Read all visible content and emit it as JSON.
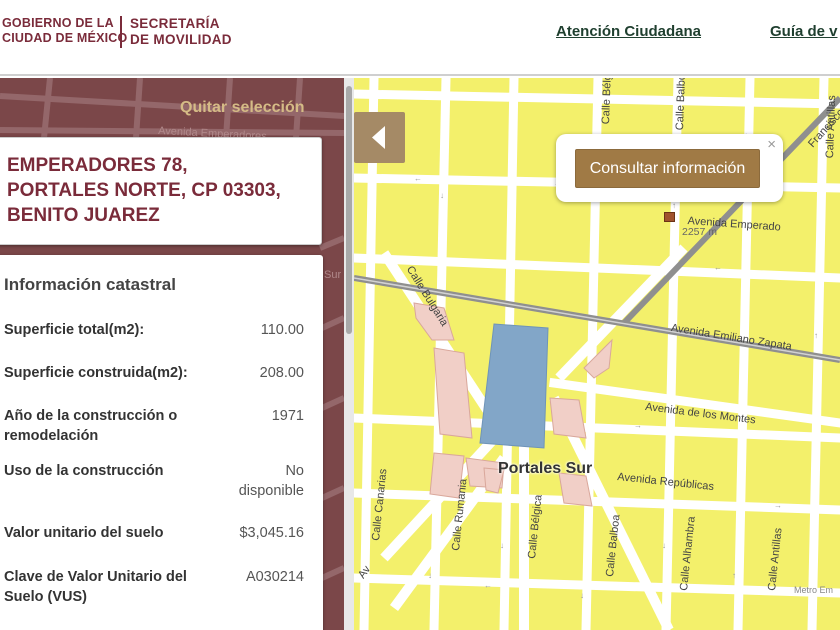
{
  "header": {
    "logo_gov_line1": "GOBIERNO DE LA",
    "logo_gov_line2": "CIUDAD DE MÉXICO",
    "logo_sec_line1": "SECRETARÍA",
    "logo_sec_line2": "DE MOVILIDAD",
    "nav": [
      "Atención Ciudadana",
      "Guía de v"
    ]
  },
  "panel": {
    "quitar_label": "Quitar selección",
    "address_lines": [
      "EMPERADORES 78,",
      "PORTALES NORTE, CP 03303,",
      "BENITO JUAREZ"
    ],
    "info_title": "Información catastral",
    "rows": [
      {
        "label": "Superficie total(m2):",
        "value": "110.00"
      },
      {
        "label": "Superficie construida(m2):",
        "value": "208.00"
      },
      {
        "label": "Año de la construcción o remodelación",
        "value": "1971"
      },
      {
        "label": "Uso de la construcción",
        "value": "No disponible"
      },
      {
        "label": "Valor unitario del suelo",
        "value": "$3,045.16"
      },
      {
        "label": "Clave de Valor Unitario del Suelo (VUS)",
        "value": "A030214"
      }
    ]
  },
  "map": {
    "popup_button": "Consultar información",
    "popup_close": "×",
    "distance_label": "2257 m",
    "place_label": "Portales Sur",
    "attribution": "Metro Em",
    "streets": {
      "emperadores": "Avenida Emperado",
      "zapata": "Avenida Emiliano Zapata",
      "montes": "Avenida de los Montes",
      "republicas": "Avenida Repúblicas",
      "bulgaria": "Calle Bulgaria",
      "belgica_top": "Calle Bélgica",
      "balboa_top": "Calle Balboa",
      "antillas_top": "Calle Antillas",
      "canarias": "Calle Canarias",
      "rumania": "Calle Rumania",
      "belgica_bottom": "Calle Bélgica",
      "balboa_bottom": "Calle Balboa",
      "alhambra": "Calle Alhambra",
      "antillas_bottom": "Calle Antillas",
      "francisco": "Francisco",
      "avenida_left": "Avenida Emperadores",
      "sur_left": "Sur",
      "av_left_bottom": "Av"
    }
  },
  "colors": {
    "brand": "#7a2b3a",
    "block": "#f3f06b",
    "street": "#ffffff",
    "park": "#82a6c8",
    "commercial": "#f1cfc7",
    "accent_button": "#a07a45"
  }
}
